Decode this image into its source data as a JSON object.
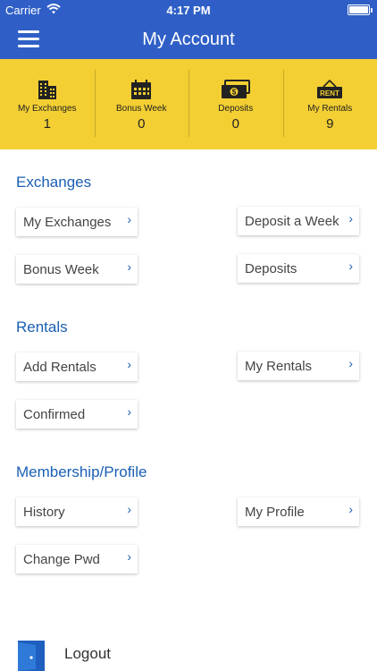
{
  "status_bar": {
    "carrier": "Carrier",
    "time": "4:17 PM"
  },
  "nav": {
    "title": "My Account"
  },
  "summary": [
    {
      "icon": "building-icon",
      "label": "My Exchanges",
      "count": "1"
    },
    {
      "icon": "calendar-icon",
      "label": "Bonus Week",
      "count": "0"
    },
    {
      "icon": "money-icon",
      "label": "Deposits",
      "count": "0"
    },
    {
      "icon": "rent-sign-icon",
      "label": "My Rentals",
      "count": "9",
      "sign_text": "RENT"
    }
  ],
  "sections": {
    "exchanges": {
      "title": "Exchanges",
      "items": [
        "My Exchanges",
        "Deposit a Week",
        "Bonus Week",
        "Deposits"
      ]
    },
    "rentals": {
      "title": "Rentals",
      "items": [
        "Add Rentals",
        "My Rentals",
        "Confirmed"
      ]
    },
    "membership": {
      "title": "Membership/Profile",
      "items": [
        "History",
        "My Profile",
        "Change Pwd"
      ]
    }
  },
  "chevron": "›",
  "logout": {
    "label": "Logout"
  },
  "colors": {
    "header_blue": "#2f5fc6",
    "summary_yellow": "#f3cf33",
    "accent_blue": "#1a5fb4"
  }
}
